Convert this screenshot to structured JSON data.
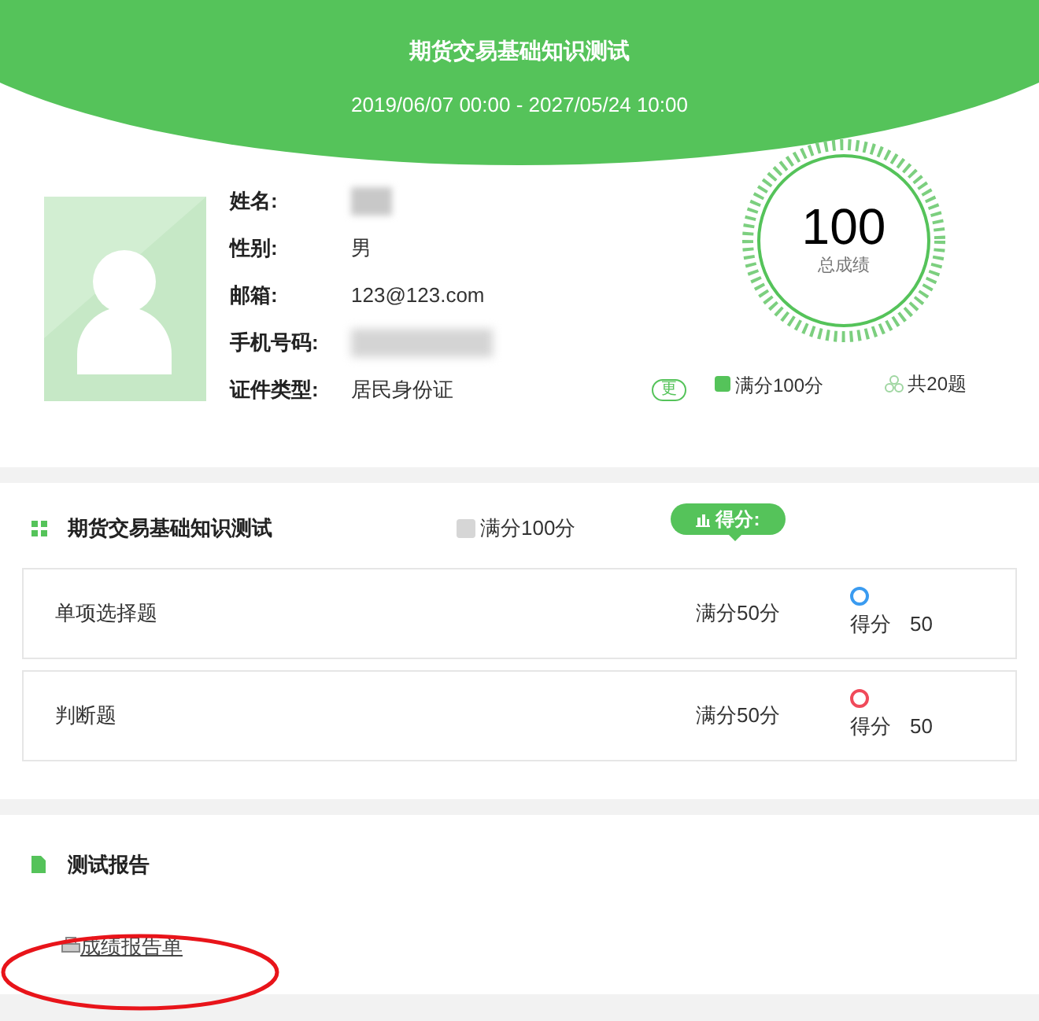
{
  "header": {
    "title": "期货交易基础知识测试",
    "period": "2019/06/07 00:00 - 2027/05/24 10:00"
  },
  "profile": {
    "fields": [
      {
        "label": "姓名:",
        "kind": "blurred"
      },
      {
        "label": "性别:",
        "kind": "text",
        "value": "男"
      },
      {
        "label": "邮箱:",
        "kind": "text",
        "value": "123@123.com"
      },
      {
        "label": "手机号码:",
        "kind": "blurred"
      },
      {
        "label": "证件类型:",
        "kind": "text",
        "value": "居民身份证",
        "tag": "更"
      }
    ],
    "score": "100",
    "score_label": "总成绩",
    "full_score": "满分100分",
    "question_count": "共20题"
  },
  "exam": {
    "title": "期货交易基础知识测试",
    "full_score": "满分100分",
    "score_tag": "得分:",
    "items": [
      {
        "name": "单项选择题",
        "full_score": "满分50分",
        "color": "#3a9bf0",
        "score_label": "得分",
        "score": "50"
      },
      {
        "name": "判断题",
        "full_score": "满分50分",
        "color": "#f04a5a",
        "score_label": "得分",
        "score": "50"
      }
    ]
  },
  "report": {
    "title": "测试报告",
    "link": "成绩报告单"
  }
}
